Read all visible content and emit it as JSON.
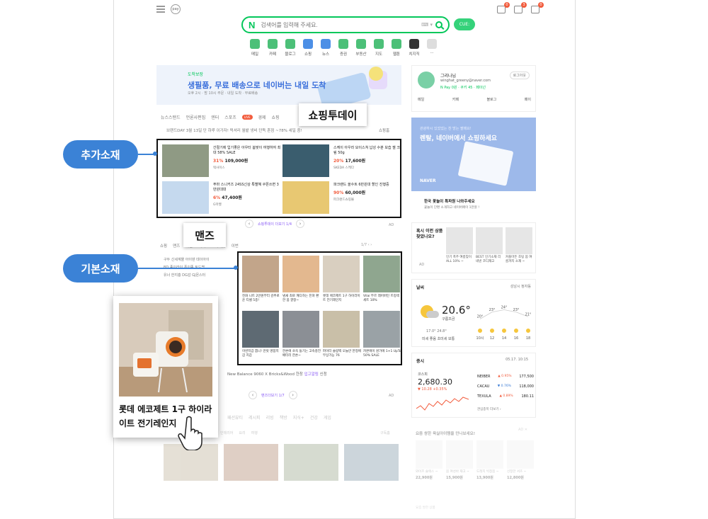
{
  "header": {
    "pay_label": "pay",
    "search_placeholder": "검색어를 입력해 주세요.",
    "kbd_hint": "⌨ ▾",
    "ai_button": "CUE:",
    "notif_counts": [
      "0",
      "3",
      "0"
    ]
  },
  "services": [
    {
      "label": "메일",
      "color": "#4cc078"
    },
    {
      "label": "카페",
      "color": "#4cc078"
    },
    {
      "label": "블로그",
      "color": "#4cc078"
    },
    {
      "label": "쇼핑",
      "color": "#4c8fe6"
    },
    {
      "label": "뉴스",
      "color": "#4c8fe6"
    },
    {
      "label": "증권",
      "color": "#4cc078"
    },
    {
      "label": "부동산",
      "color": "#4cc078"
    },
    {
      "label": "지도",
      "color": "#4cc078"
    },
    {
      "label": "웹툰",
      "color": "#4cc078"
    },
    {
      "label": "치지직",
      "color": "#333333"
    },
    {
      "label": "···",
      "color": "#dddddd"
    }
  ],
  "banner": {
    "tag": "도착보장",
    "title": "생필품, 무료 배송으로 네이버는 내일 도착",
    "sub": "오후 2시 · 밤 10시 주문 · 내일 도착 · 무료배송"
  },
  "news_tabs": [
    "뉴스스탠드",
    "언론사편집",
    "엔터",
    "스포츠",
    "경제",
    "쇼핑"
  ],
  "live_badge": "LIVE",
  "brand_day": "브랜드DAY  3월 13일 단 하루 이가자! 럭셔리 월밭 냉비 단독 혼점 ~78% 세일 중!",
  "brand_more": "쇼핑홈",
  "callouts": {
    "shopping_today": "쇼핑투데이",
    "manz": "맨즈",
    "extra_ads": "추가소재",
    "basic_ads": "기본소재"
  },
  "extra_ads": [
    {
      "title": "간절기에 입기좋은 아우터 봄맞이 여행하여 최대 58% SALE",
      "pct": "31%",
      "price": "109,000원",
      "seller": "텍사이스",
      "color": "#8f9a84"
    },
    {
      "title": "스케이 아우라 모이스쳐 납성 수분 보습 젤 크림 50g",
      "pct": "20%",
      "price": "17,600원",
      "seller": "SKEDA 스케다",
      "color": "#3a5d6e"
    },
    {
      "title": "푸마 스니커즈 24SS신상 특별혜 쿠폰쓰면 3만원대대",
      "pct": "6%",
      "price": "47,400원",
      "seller": "G마켓",
      "color": "#c5d9ee"
    },
    {
      "title": "파크랜드 올수트 6만원대 할인 진행중",
      "pct": "90%",
      "price": "60,000원",
      "seller": "파크랜드쇼핑몰",
      "color": "#e8c872"
    }
  ],
  "pager1": {
    "text": "쇼핑투데이 더보기 1/4",
    "prev": "‹",
    "next": "›",
    "ad": "AD"
  },
  "shop_tabs": [
    "쇼핑",
    "맨즈",
    "타운",
    "라이브",
    "어바웃",
    "이번"
  ],
  "pager2": "1/7  ‹  ›",
  "cat_list": [
    "구두   신세계몰   아이덴   데이아이",
    "BD   종이라이   폼이종   토드백",
    "유너   한지흥   DG감   GJ몬스터"
  ],
  "base_ads": [
    {
      "text": "진화 니트 2만원부터 감추로운 티셀 5종!",
      "color": "#c2a58a"
    },
    {
      "text": "냄새 최로 깨디하는 진혀 편한 봄 깔창~",
      "color": "#e3b88f"
    },
    {
      "text": "롯데 에코제트 1구 하이라이트 전기레인지",
      "color": "#d9cfc0"
    },
    {
      "text": "Vilai 뚜르 레어버틴 트렁색세트 10%",
      "color": "#8fa68f"
    },
    {
      "text": "이번지갑 뽑니! 만릿 명함지갑 지갑",
      "color": "#5e6a73"
    },
    {
      "text": "한손에 쏘옥 들기는 고속충전 배터리 한손~",
      "color": "#8b8f95"
    },
    {
      "text": "파이터 슬링백 오늘만 한정에 무상가능 76",
      "color": "#c9bfa8"
    },
    {
      "text": "카본에이 원가에 1+1 UpTo 50% SALE",
      "color": "#9aa2a6"
    }
  ],
  "more_row": {
    "text": "New Balance 9060 X Bricks&Wood 한창 ",
    "highlight": "입고알림",
    "tail": " 신청"
  },
  "pager3": {
    "text": "맨즈더보기 1/7",
    "prev": "‹",
    "next": "›",
    "ad": "AD"
  },
  "bottom_tabs": [
    "패션뷰티",
    "레시피",
    "리빙",
    "책방",
    "지식+",
    "건강",
    "게임"
  ],
  "sub_tabs": [
    "인테리어",
    "요리",
    "여행"
  ],
  "sub_more": "구독홈",
  "bottom_imgs": [
    "#b5a58a",
    "#a6785c",
    "#8c9a7a",
    "#6e8a9a"
  ],
  "profile": {
    "name": "그리나님",
    "mail": "winghat_greeny@naver.com",
    "npay": "N Pay 0원  · 쿠키 45  · 페이넌",
    "logout": "로그아웃",
    "menu": [
      "메일",
      "카페",
      "블로그",
      "페이"
    ]
  },
  "naver_ad": {
    "sub": "관광하시 있었었는 찬 방는 팔매요!",
    "title": "렌탈, 네이버에서 쇼핑하세요",
    "logo": "NAVER"
  },
  "promo": {
    "title": "한국 꽃놀이 특파원 나와주세요",
    "sub": "꽃놀이 단편 소개하고 네이버페이 1만원 !"
  },
  "rec": {
    "question": "혹시 이런 상품 찾았나요?",
    "ad": "AD",
    "items": [
      "인기 폭주 여름맞이 ALL 10% ~",
      "BEST 인기소재 리네넨 코디재고",
      "커플마든 조팅 봄 여름까지 소재 ~"
    ]
  },
  "weather": {
    "title": "날씨",
    "loc": "성남시 정자동",
    "temp": "20.6°",
    "cond": "구름조금",
    "range": "17.0°  24.8°",
    "dust": "미세 좋음  초미세 보통",
    "hours": [
      "10시",
      "12",
      "14",
      "16",
      "18"
    ],
    "temps": [
      20,
      23,
      24,
      23,
      21
    ]
  },
  "stock": {
    "title": "증시",
    "date": "05.17. 10:15",
    "name": "코스피",
    "value": "2,680.30",
    "change": "▼ 10.28  +0.35%",
    "rows": [
      {
        "name": "NEIBER",
        "chg": "▲ 0.95%",
        "val": "177,500",
        "color": "#f25c3d"
      },
      {
        "name": "CACAU",
        "chg": "▼ 0.76%",
        "val": "118,000",
        "color": "#3a7bd5"
      },
      {
        "name": "TEXULA",
        "chg": "▲ 0.89%",
        "val": "180.11",
        "color": "#f25c3d"
      }
    ],
    "more": "관심종목 더보기 ›"
  },
  "rec2": {
    "title": "요즘 쌍한 육실아이템을 만나보세요!",
    "ad": "AD ✕",
    "items": [
      {
        "tx": "와이즈 슬렉스 ~",
        "pr": "22,900원"
      },
      {
        "tx": "봄 여성바 재고 ~",
        "pr": "15,900원"
      },
      {
        "tx": "도레지 빅청봄 ~",
        "pr": "13,900원"
      },
      {
        "tx": "선정한 셔츠 ~",
        "pr": "12,800원"
      }
    ],
    "foot": "요즘 쌍한 상품"
  },
  "popup": {
    "caption": "롯데 에코제트 1구 하이라이트 전기레인지"
  }
}
